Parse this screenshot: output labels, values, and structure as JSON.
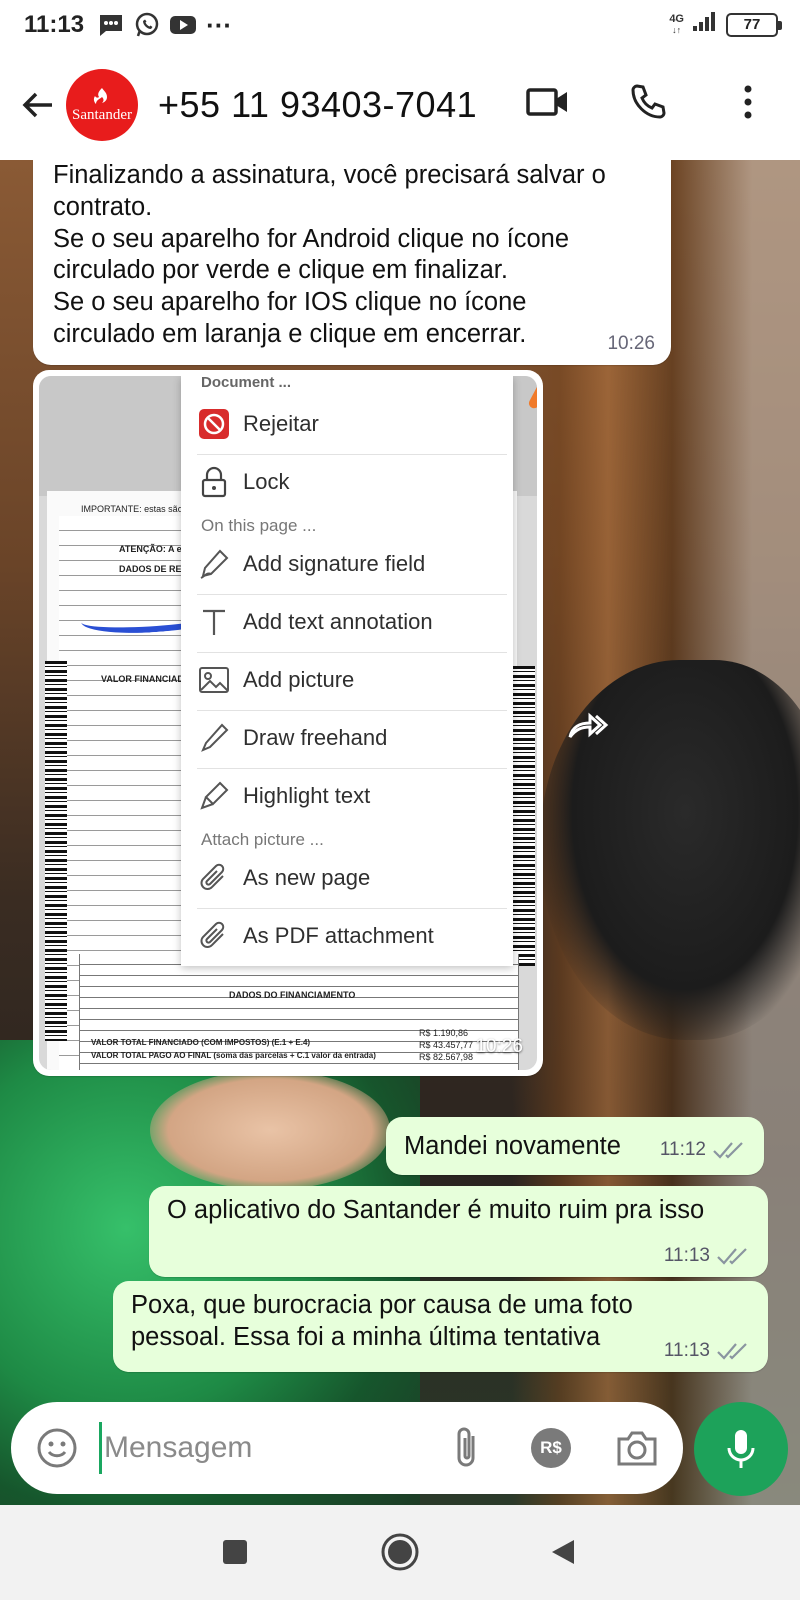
{
  "status_bar": {
    "time": "11:13",
    "network": "4G",
    "battery": "77"
  },
  "header": {
    "avatar_text": "Santander",
    "contact_name": "+55 11 93403-7041"
  },
  "messages": {
    "m1": {
      "lines": [
        "Finalizando a assinatura, você precisará salvar o",
        "contrato.",
        "Se o seu aparelho for Android clique no ícone",
        "circulado por verde e clique em finalizar.",
        "Se o seu aparelho for IOS clique no ícone",
        "circulado em laranja e clique em encerrar."
      ],
      "time": "10:26"
    },
    "image_msg": {
      "time": "10:26",
      "menu": {
        "title": "Document ...",
        "items": [
          {
            "label": "Rejeitar"
          },
          {
            "label": "Lock"
          }
        ],
        "section_page": "On this page ...",
        "page_items": [
          {
            "label": "Add signature field"
          },
          {
            "label": "Add text annotation"
          },
          {
            "label": "Add picture"
          },
          {
            "label": "Draw freehand"
          },
          {
            "label": "Highlight text"
          }
        ],
        "section_attach": "Attach picture ...",
        "attach_items": [
          {
            "label": "As new page"
          },
          {
            "label": "As PDF attachment"
          }
        ]
      },
      "doc_text": {
        "important": "IMPORTANTE: estas são as p",
        "atencao": "ATENÇÃO: A efeti",
        "dados_resp": "DADOS DE RESP",
        "valor_fin": "VALOR FINANCIADO",
        "dados_fin": "DADOS DO FINANCIAMENTO",
        "valor_total_fin": "VALOR TOTAL FINANCIADO (COM IMPOSTOS) (E.1 + E.4)",
        "valor_total_pago": "VALOR TOTAL PAGO AO FINAL (soma das parcelas + C.1 valor da entrada)",
        "val1": "R$ 43.457,77",
        "val2": "R$ 82.567,98",
        "val3": "R$ 1.190,86"
      }
    },
    "m2": {
      "text": "Mandei novamente",
      "time": "11:12"
    },
    "m3": {
      "text": "O aplicativo do Santander é muito ruim pra isso",
      "time": "11:13"
    },
    "m4": {
      "lines": [
        "Poxa, que burocracia por causa de uma foto",
        "pessoal. Essa foi a minha última tentativa"
      ],
      "time": "11:13"
    }
  },
  "input": {
    "placeholder": "Mensagem",
    "pay_label": "R$"
  },
  "colors": {
    "accent": "#1da25a",
    "outgoing_bubble": "#e7ffdb",
    "brand": "#e81c1c"
  }
}
